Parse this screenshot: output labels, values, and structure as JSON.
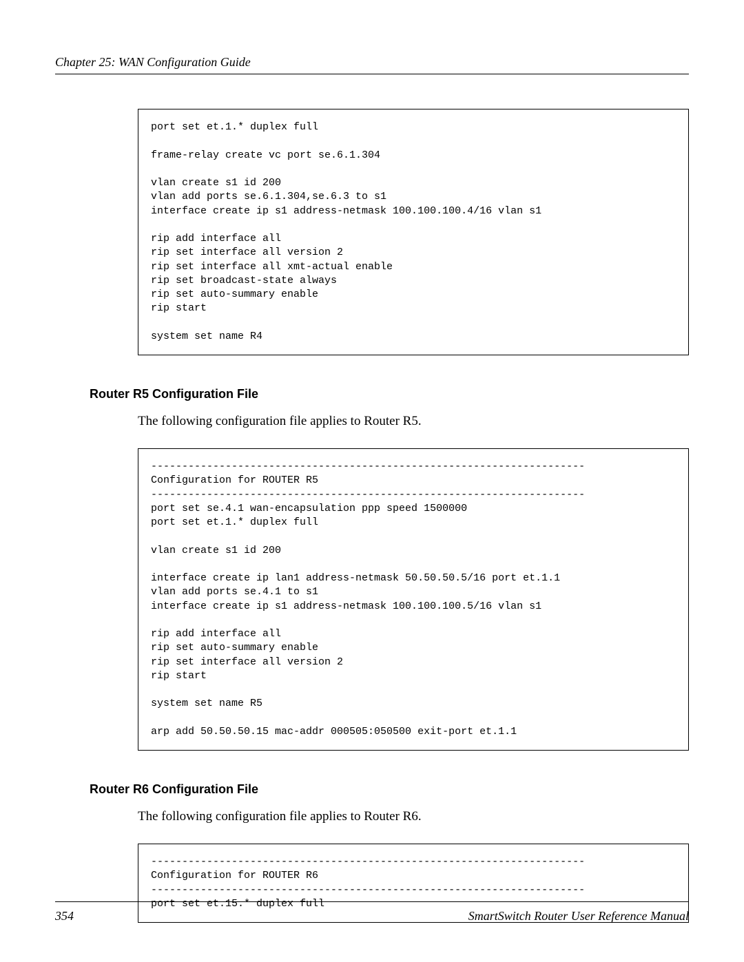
{
  "header": {
    "chapter": "Chapter 25: WAN Configuration Guide"
  },
  "codebox1": "port set et.1.* duplex full\n\nframe-relay create vc port se.6.1.304\n\nvlan create s1 id 200\nvlan add ports se.6.1.304,se.6.3 to s1\ninterface create ip s1 address-netmask 100.100.100.4/16 vlan s1\n\nrip add interface all\nrip set interface all version 2\nrip set interface all xmt-actual enable\nrip set broadcast-state always\nrip set auto-summary enable\nrip start\n\nsystem set name R4",
  "section1": {
    "heading": "Router R5 Configuration File",
    "intro": "The following configuration file applies to Router R5."
  },
  "codebox2": "----------------------------------------------------------------------\nConfiguration for ROUTER R5\n----------------------------------------------------------------------\nport set se.4.1 wan-encapsulation ppp speed 1500000\nport set et.1.* duplex full\n\nvlan create s1 id 200\n\ninterface create ip lan1 address-netmask 50.50.50.5/16 port et.1.1\nvlan add ports se.4.1 to s1\ninterface create ip s1 address-netmask 100.100.100.5/16 vlan s1\n\nrip add interface all\nrip set auto-summary enable\nrip set interface all version 2\nrip start\n\nsystem set name R5\n\narp add 50.50.50.15 mac-addr 000505:050500 exit-port et.1.1",
  "section2": {
    "heading": "Router R6 Configuration File",
    "intro": "The following configuration file applies to Router R6."
  },
  "codebox3": "----------------------------------------------------------------------\nConfiguration for ROUTER R6\n----------------------------------------------------------------------\nport set et.15.* duplex full",
  "footer": {
    "page": "354",
    "manual": "SmartSwitch Router User Reference Manual"
  }
}
